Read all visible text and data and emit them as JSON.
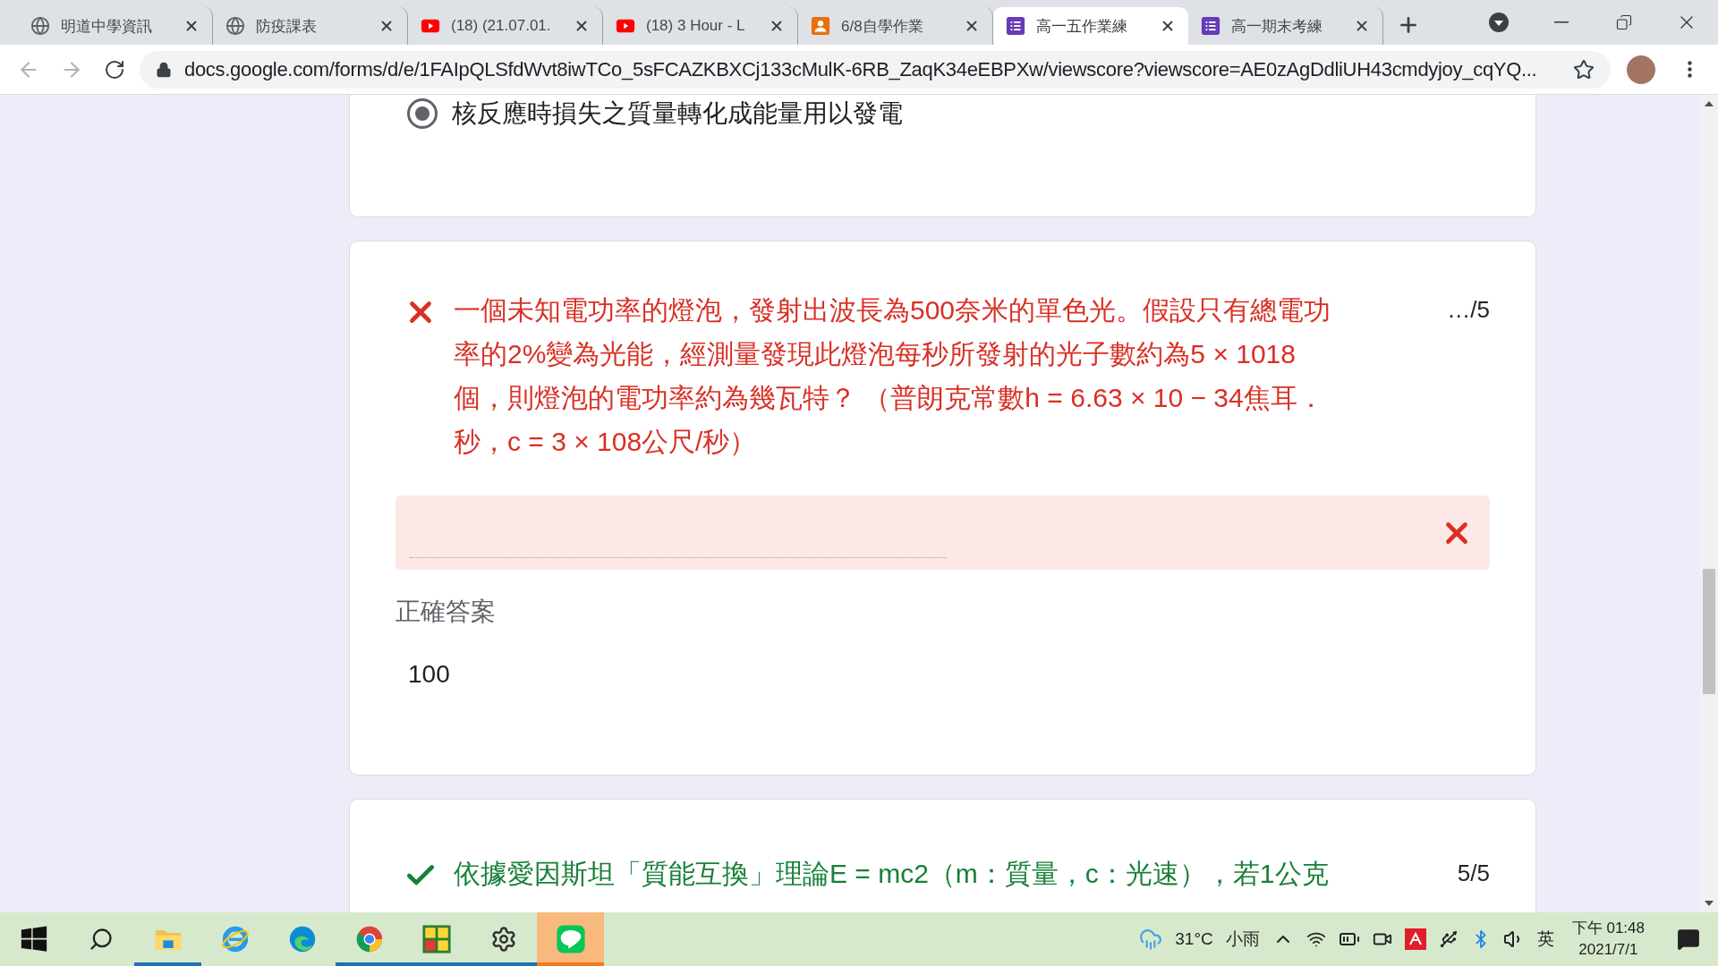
{
  "browser": {
    "tabs": [
      {
        "title": "明道中學資訊",
        "kind": "globe",
        "selected": false
      },
      {
        "title": "防疫課表",
        "kind": "globe",
        "selected": false
      },
      {
        "title": "(18) (21.07.01.",
        "kind": "video",
        "selected": false
      },
      {
        "title": "(18) 3 Hour - L",
        "kind": "video",
        "selected": false
      },
      {
        "title": "6/8自學作業",
        "kind": "classroom",
        "selected": false
      },
      {
        "title": "高一五作業練",
        "kind": "form",
        "selected": true
      },
      {
        "title": "高一期末考練",
        "kind": "form",
        "selected": false
      }
    ],
    "url": "docs.google.com/forms/d/e/1FAIpQLSfdWvt8iwTCo_5sFCAZKBXCj133cMulK-6RB_ZaqK34eEBPXw/viewscore?viewscore=AE0zAgDdliUH43cmdyjoy_cqYQ..."
  },
  "form": {
    "cards": [
      {
        "kind": "choice",
        "option": "核反應時損失之質量轉化成能量用以發電",
        "selected": true
      },
      {
        "kind": "question",
        "correct": false,
        "question": "一個未知電功率的燈泡，發射出波長為500奈米的單色光。假設只有總電功率的2%變為光能，經測量發現此燈泡每秒所發射的光子數約為5 × 1018個，則燈泡的電功率約為幾瓦特？ （普朗克常數h = 6.63 × 10 − 34焦耳．秒，c = 3 × 108公尺/秒）",
        "score": "…/5",
        "correct_answer_label": "正確答案",
        "correct_answer": "100"
      },
      {
        "kind": "question",
        "correct": true,
        "question": "依據愛因斯坦「質能互換」理論E = mc2（m：質量，c：光速），若1公克",
        "score": "5/5"
      }
    ]
  },
  "taskbar": {
    "apps": [
      {
        "kind": "start",
        "running": false,
        "active": false
      },
      {
        "kind": "search",
        "running": false,
        "active": false
      },
      {
        "kind": "explorer",
        "running": true,
        "active": false
      },
      {
        "kind": "ie",
        "running": false,
        "active": false
      },
      {
        "kind": "edge",
        "running": false,
        "active": false
      },
      {
        "kind": "chrome",
        "running": true,
        "active": false
      },
      {
        "kind": "exam",
        "running": true,
        "active": false
      },
      {
        "kind": "settings",
        "running": true,
        "active": false
      },
      {
        "kind": "line",
        "running": true,
        "active": true
      }
    ],
    "temperature": "31°C",
    "weather": "小雨",
    "ime": "英",
    "time": "下午 01:48",
    "date": "2021/7/1"
  }
}
